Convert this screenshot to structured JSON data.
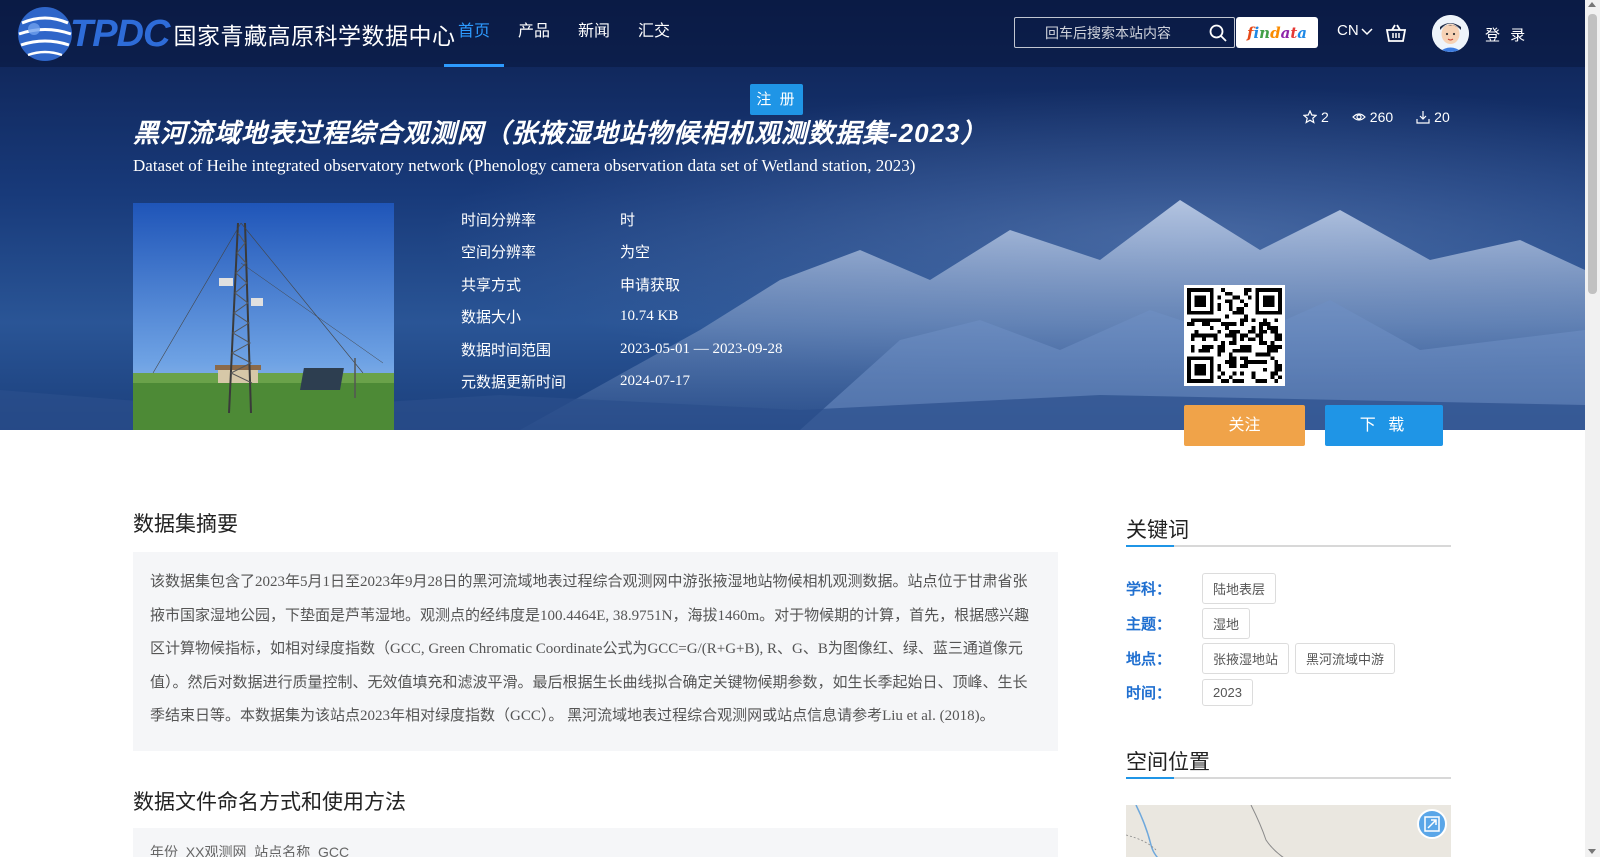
{
  "header": {
    "logo_tpdc": "TPDC",
    "logo_cn": "国家青藏高原科学数据中心",
    "nav": [
      {
        "label": "首页",
        "active": true
      },
      {
        "label": "产品",
        "active": false
      },
      {
        "label": "新闻",
        "active": false
      },
      {
        "label": "汇交",
        "active": false
      }
    ],
    "search_placeholder": "回车后搜索本站内容",
    "findata_label": "findata",
    "lang_label": "CN",
    "login_label": "登 录",
    "register_label": "注 册"
  },
  "dataset": {
    "title_cn": "黑河流域地表过程综合观测网（张掖湿地站物候相机观测数据集-2023）",
    "title_en": "Dataset of Heihe integrated observatory network (Phenology camera observation data set of Wetland station, 2023)",
    "stats": {
      "favorites": "2",
      "views": "260",
      "downloads": "20"
    },
    "meta": [
      {
        "key": "时间分辨率",
        "value": "时"
      },
      {
        "key": "空间分辨率",
        "value": "为空"
      },
      {
        "key": "共享方式",
        "value": "申请获取"
      },
      {
        "key": "数据大小",
        "value": "10.74 KB"
      },
      {
        "key": "数据时间范围",
        "value": "2023-05-01 — 2023-09-28"
      },
      {
        "key": "元数据更新时间",
        "value": "2024-07-17"
      }
    ],
    "follow_label": "关注",
    "download_label": "下 载"
  },
  "main": {
    "abstract_title": "数据集摘要",
    "abstract_text": "该数据集包含了2023年5月1日至2023年9月28日的黑河流域地表过程综合观测网中游张掖湿地站物候相机观测数据。站点位于甘肃省张掖市国家湿地公园，下垫面是芦苇湿地。观测点的经纬度是100.4464E, 38.9751N，海拔1460m。对于物候期的计算，首先，根据感兴趣区计算物候指标，如相对绿度指数（GCC, Green Chromatic Coordinate公式为GCC=G/(R+G+B), R、G、B为图像红、绿、蓝三通道像元值）。然后对数据进行质量控制、无效值填充和滤波平滑。最后根据生长曲线拟合确定关键物候期参数，如生长季起始日、顶峰、生长季结束日等。本数据集为该站点2023年相对绿度指数（GCC）。 黑河流域地表过程综合观测网或站点信息请参考Liu et al. (2018)。",
    "naming_title": "数据文件命名方式和使用方法",
    "naming_text": "年份_XX观测网_站点名称_GCC"
  },
  "sidebar": {
    "keywords_title": "关键词",
    "keywords": [
      {
        "label": "学科：",
        "tags": [
          "陆地表层"
        ]
      },
      {
        "label": "主题：",
        "tags": [
          "湿地"
        ]
      },
      {
        "label": "地点：",
        "tags": [
          "张掖湿地站",
          "黑河流域中游"
        ]
      },
      {
        "label": "时间：",
        "tags": [
          "2023"
        ]
      }
    ],
    "location_title": "空间位置"
  },
  "colors": {
    "accent": "#1f95e6",
    "follow": "#f0a349",
    "keyword_label": "#1f6fd0"
  }
}
